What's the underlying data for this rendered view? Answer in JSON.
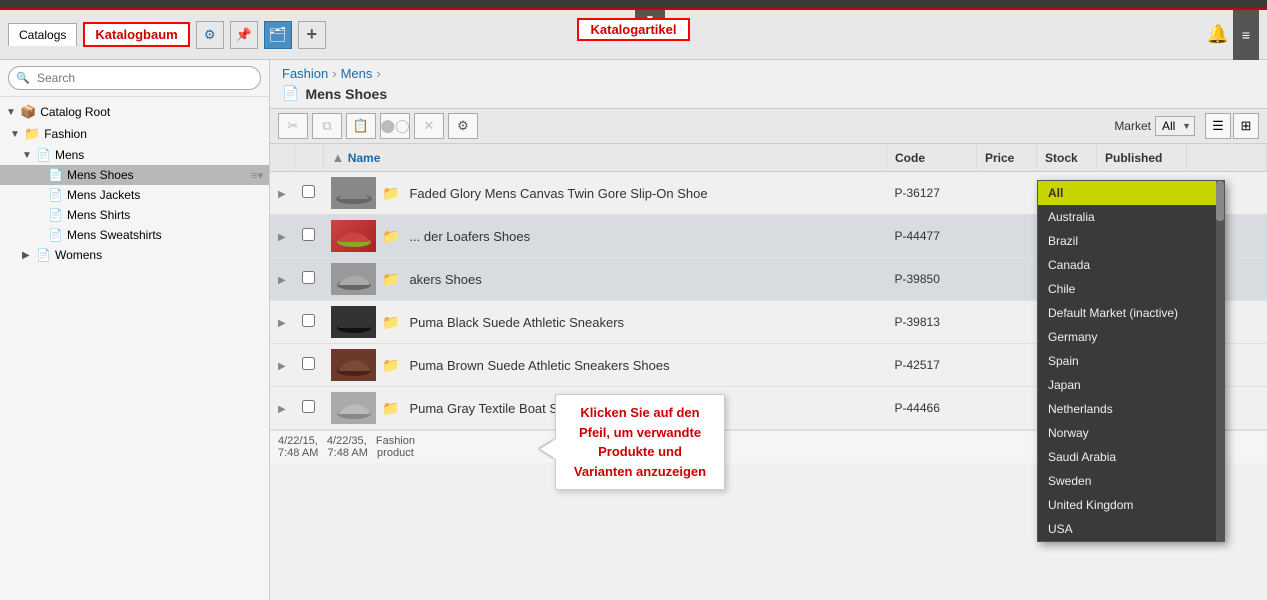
{
  "topbar": {
    "color": "#cc0000"
  },
  "header": {
    "catalogs_tab": "Catalogs",
    "katalogbaum_label": "Katalogbaum",
    "katalogartikel_label": "Katalogartikel",
    "add_btn_label": "+",
    "gear_icon": "⚙",
    "pin_icon": "📌",
    "bell_icon": "🔔",
    "lines_icon": "≡",
    "dropdown_arrow": "▼"
  },
  "sidebar": {
    "search_placeholder": "Search",
    "tree": [
      {
        "id": "catalog-root",
        "label": "Catalog Root",
        "indent": 0,
        "expanded": true,
        "icon": "📦",
        "arrow": "▼"
      },
      {
        "id": "fashion",
        "label": "Fashion",
        "indent": 1,
        "expanded": true,
        "icon": "📁",
        "arrow": "▼"
      },
      {
        "id": "mens",
        "label": "Mens",
        "indent": 2,
        "expanded": true,
        "icon": "📄",
        "arrow": "▼"
      },
      {
        "id": "mens-shoes",
        "label": "Mens Shoes",
        "indent": 3,
        "selected": true,
        "icon": "📄",
        "arrow": ""
      },
      {
        "id": "mens-jackets",
        "label": "Mens Jackets",
        "indent": 3,
        "icon": "📄",
        "arrow": ""
      },
      {
        "id": "mens-shirts",
        "label": "Mens Shirts",
        "indent": 3,
        "icon": "📄",
        "arrow": ""
      },
      {
        "id": "mens-sweatshirts",
        "label": "Mens Sweatshirts",
        "indent": 3,
        "icon": "📄",
        "arrow": ""
      },
      {
        "id": "womens",
        "label": "Womens",
        "indent": 2,
        "icon": "📄",
        "arrow": "▶"
      }
    ]
  },
  "breadcrumb": {
    "items": [
      "Fashion",
      "Mens"
    ],
    "current": "Mens Shoes"
  },
  "content": {
    "page_title": "Mens Shoes",
    "page_title_icon": "📄"
  },
  "toolbar": {
    "cut_icon": "✂",
    "copy_icon": "⧉",
    "paste_icon": "📋",
    "move_icon": "⇄",
    "delete_icon": "✕",
    "settings_icon": "⚙",
    "market_label": "Market",
    "market_value": "All",
    "list_view_icon": "☰",
    "grid_view_icon": "⊞"
  },
  "table": {
    "columns": [
      "",
      "",
      "Name",
      "Code",
      "Price",
      "Stock",
      "Published"
    ],
    "rows": [
      {
        "id": 1,
        "name": "Faded Glory Mens Canvas Twin Gore Slip-On Shoe",
        "code": "P-36127",
        "price": "",
        "stock": "",
        "published": true,
        "has_thumb": true,
        "thumb_class": "thumb-shoe-canvas",
        "date_info": "4/22/15, 4/22/35, Fashion 7:48 AM 7:48 AM product"
      },
      {
        "id": 2,
        "name": "Leather Loafers Shoes",
        "name_prefix": "... der Loafers Shoes",
        "code": "P-44477",
        "price": "",
        "stock": "",
        "published": true,
        "has_thumb": true,
        "thumb_class": "thumb-shoe-loafer",
        "highlight": true
      },
      {
        "id": 3,
        "name": "akers Shoes",
        "code": "P-39850",
        "price": "",
        "stock": "",
        "published": true,
        "has_thumb": true,
        "thumb_class": "thumb-shoe-canvas",
        "highlight": true
      },
      {
        "id": 4,
        "name": "Puma Black Suede Athletic Sneakers",
        "code": "P-39813",
        "price": "",
        "stock": "",
        "published": true,
        "has_thumb": true,
        "thumb_class": "thumb-shoe-suede-black"
      },
      {
        "id": 5,
        "name": "Puma Brown Suede Athletic Sneakers Shoes",
        "code": "P-42517",
        "price": "",
        "stock": "",
        "published": true,
        "has_thumb": true,
        "thumb_class": "thumb-shoe-sneakers"
      },
      {
        "id": 6,
        "name": "Puma Gray Textile Boat Shoes",
        "code": "P-44466",
        "price": "",
        "stock": "",
        "published": true,
        "has_thumb": true,
        "thumb_class": "thumb-shoe-gray"
      }
    ]
  },
  "tooltip": {
    "text": "Klicken Sie auf den Pfeil, um verwandte Produkte und Varianten anzuzeigen"
  },
  "market_dropdown": {
    "options": [
      {
        "value": "All",
        "active": true
      },
      {
        "value": "Australia"
      },
      {
        "value": "Brazil"
      },
      {
        "value": "Canada"
      },
      {
        "value": "Chile"
      },
      {
        "value": "Default Market (inactive)"
      },
      {
        "value": "Germany"
      },
      {
        "value": "Spain"
      },
      {
        "value": "Japan"
      },
      {
        "value": "Netherlands"
      },
      {
        "value": "Norway"
      },
      {
        "value": "Saudi Arabia"
      },
      {
        "value": "Sweden"
      },
      {
        "value": "United Kingdom"
      },
      {
        "value": "USA"
      }
    ]
  }
}
